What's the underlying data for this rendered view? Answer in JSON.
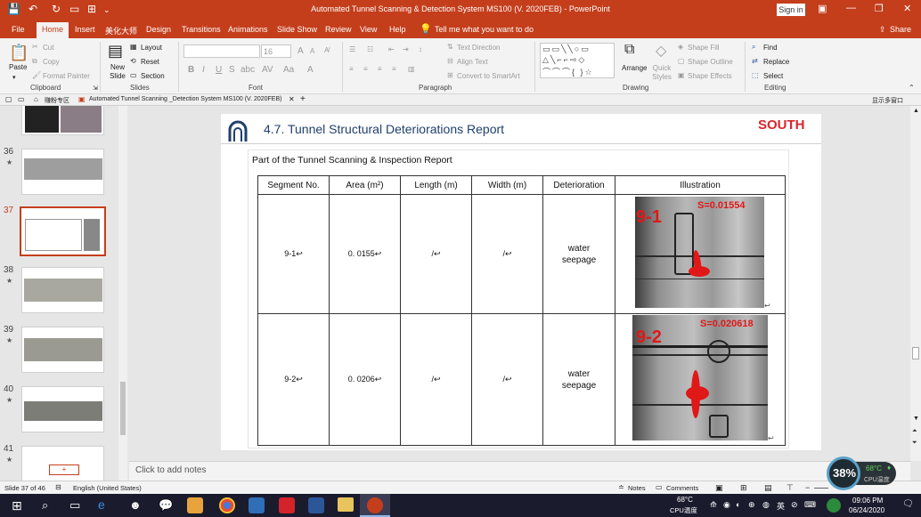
{
  "window": {
    "title": "Automated Tunnel Scanning & Detection System MS100 (V. 2020FEB)  -  PowerPoint",
    "sign_in": "Sign in",
    "share": "Share"
  },
  "menu": [
    "File",
    "Home",
    "Insert",
    "美化大师",
    "Design",
    "Transitions",
    "Animations",
    "Slide Show",
    "Review",
    "View",
    "Help"
  ],
  "tell_me": "Tell me what you want to do",
  "ribbon": {
    "clipboard": {
      "paste": "Paste",
      "cut": "Cut",
      "copy": "Copy",
      "format_painter": "Format Painter",
      "label": "Clipboard"
    },
    "slides": {
      "new_slide": "New Slide",
      "layout": "Layout",
      "reset": "Reset",
      "section": "Section",
      "label": "Slides"
    },
    "font": {
      "size": "16",
      "label": "Font"
    },
    "paragraph": {
      "text_direction": "Text Direction",
      "align_text": "Align Text",
      "convert": "Convert to SmartArt",
      "label": "Paragraph"
    },
    "drawing": {
      "arrange": "Arrange",
      "quick_styles": "Quick Styles",
      "shape_fill": "Shape Fill",
      "shape_outline": "Shape Outline",
      "shape_effects": "Shape Effects",
      "label": "Drawing"
    },
    "editing": {
      "find": "Find",
      "replace": "Replace",
      "select": "Select",
      "label": "Editing"
    }
  },
  "doc_tabs": {
    "home_tab": "赚粉专区",
    "doc_tab": "Automated Tunnel Scanning _Detection System MS100 (V. 2020FEB)",
    "right": "显示多窗口"
  },
  "thumbnails": [
    {
      "num": "36"
    },
    {
      "num": "37"
    },
    {
      "num": "38"
    },
    {
      "num": "39"
    },
    {
      "num": "40"
    },
    {
      "num": "41"
    }
  ],
  "slide": {
    "heading": "4.7. Tunnel Structural Deteriorations Report",
    "brand": "SOUTH",
    "subtitle": "Part of the Tunnel Scanning & Inspection Report",
    "table": {
      "headers": [
        "Segment No.",
        "Area (m²)",
        "Length (m)",
        "Width (m)",
        "Deterioration",
        "Illustration"
      ],
      "rows": [
        {
          "segment": "9-1↩",
          "area": "0. 0155↩",
          "length": "/↩",
          "width": "/↩",
          "deterioration": "water seepage",
          "img_label": "9-1",
          "img_value": "S=0.01554"
        },
        {
          "segment": "9-2↩",
          "area": "0. 0206↩",
          "length": "/↩",
          "width": "/↩",
          "deterioration": "water seepage",
          "img_label": "9-2",
          "img_value": "S=0.020618"
        }
      ]
    }
  },
  "notes_placeholder": "Click to add notes",
  "status": {
    "slide_info": "Slide 37 of 46",
    "language": "English (United States)",
    "notes": "Notes",
    "comments": "Comments"
  },
  "widget": {
    "cpu_percent": "38%",
    "temp": "68°C",
    "temp_label": "CPU温度"
  },
  "taskbar": {
    "temp": "68°C",
    "temp_label": "CPU温度",
    "ime": "英",
    "time": "09:06 PM",
    "date": "06/24/2020"
  }
}
